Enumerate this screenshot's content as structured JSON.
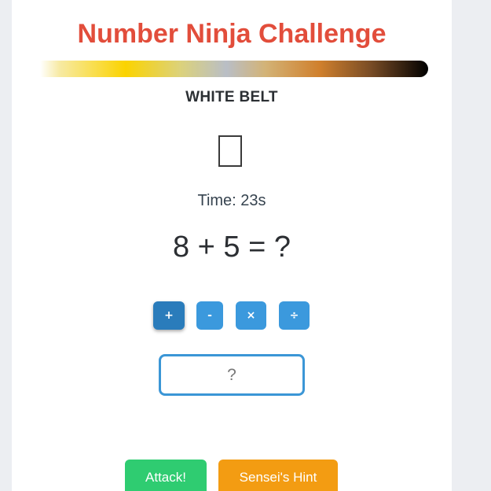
{
  "game": {
    "title": "Number Ninja Challenge",
    "belt": {
      "name": "WHITE BELT",
      "icon": "missing-glyph-box"
    },
    "timer": "Time: 23s",
    "problem": "8 + 5 = ?",
    "operators": [
      {
        "symbol": "+",
        "name": "add",
        "active": true
      },
      {
        "symbol": "-",
        "name": "subtract",
        "active": false
      },
      {
        "symbol": "×",
        "name": "multiply",
        "active": false
      },
      {
        "symbol": "÷",
        "name": "divide",
        "active": false
      }
    ],
    "answer": {
      "value": "",
      "placeholder": "?"
    },
    "actions": {
      "attack_label": "Attack!",
      "hint_label": "Sensei's Hint"
    }
  },
  "colors": {
    "title": "#e24d3b",
    "operator_button": "#3b99dd",
    "operator_button_active": "#2a7cbb",
    "input_border": "#3b96d6",
    "attack_button": "#2fcc71",
    "hint_button": "#f39c12",
    "page_background": "#eceef2",
    "card_background": "#ffffff"
  }
}
